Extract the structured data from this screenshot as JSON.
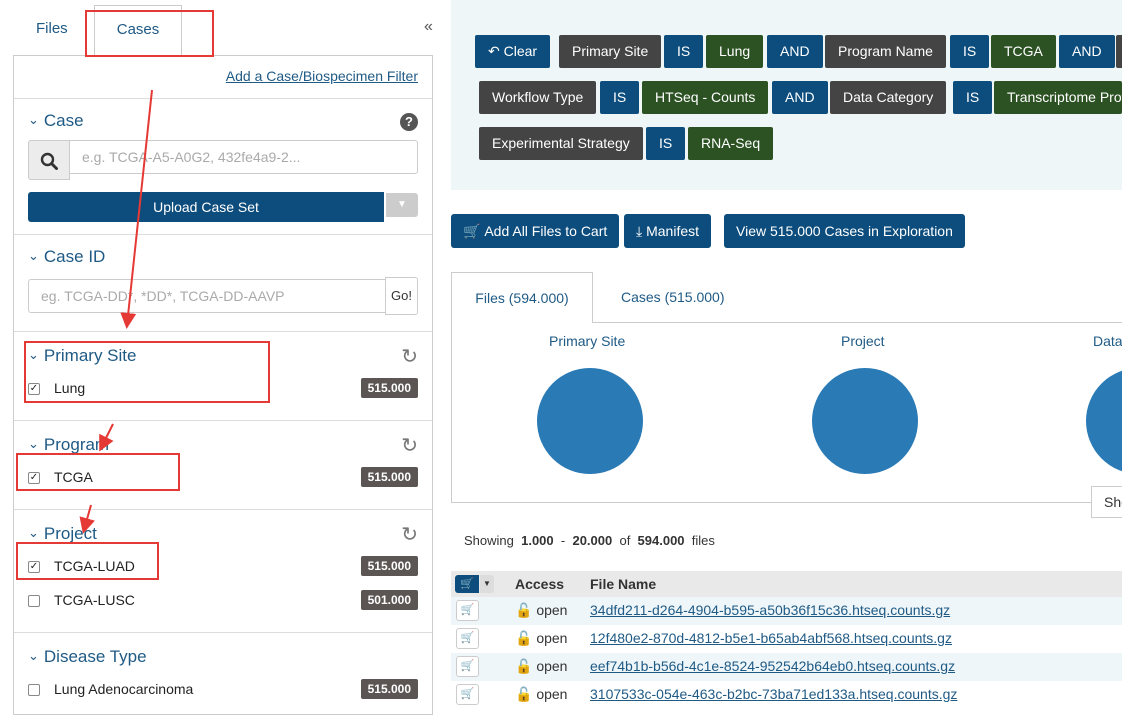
{
  "left_tabs": {
    "files": "Files",
    "cases": "Cases",
    "collapse": "«"
  },
  "add_filter": "Add a Case/Biospecimen Filter",
  "case_section": {
    "title": "Case",
    "help": "?",
    "search_placeholder": "e.g. TCGA-A5-A0G2, 432fe4a9-2...",
    "upload_label": "Upload Case Set"
  },
  "caseid_section": {
    "title": "Case ID",
    "placeholder": "eg. TCGA-DD*, *DD*, TCGA-DD-AAVP",
    "go": "Go!"
  },
  "facets": [
    {
      "title": "Primary Site",
      "items": [
        {
          "label": "Lung",
          "count": "515.000",
          "checked": true
        }
      ]
    },
    {
      "title": "Program",
      "items": [
        {
          "label": "TCGA",
          "count": "515.000",
          "checked": true
        }
      ]
    },
    {
      "title": "Project",
      "items": [
        {
          "label": "TCGA-LUAD",
          "count": "515.000",
          "checked": true
        },
        {
          "label": "TCGA-LUSC",
          "count": "501.000",
          "checked": false
        }
      ]
    },
    {
      "title": "Disease Type",
      "items": [
        {
          "label": "Lung Adenocarcinoma",
          "count": "515.000",
          "checked": false
        }
      ]
    }
  ],
  "query": {
    "clear": "Clear",
    "row1": [
      "Primary Site",
      "IS",
      "Lung",
      "AND",
      "Program Name",
      "IS",
      "TCGA",
      "AND"
    ],
    "row2": [
      "Workflow Type",
      "IS",
      "HTSeq - Counts",
      "AND",
      "Data Category",
      "IS",
      "Transcriptome Profiling"
    ],
    "row3": [
      "Experimental Strategy",
      "IS",
      "RNA-Seq"
    ]
  },
  "actions": {
    "add_all": "Add All Files to Cart",
    "manifest": "Manifest",
    "view_cases": "View 515.000 Cases in Exploration"
  },
  "result_tabs": {
    "files": "Files (594.000)",
    "cases": "Cases (515.000)"
  },
  "summary_charts": [
    "Primary Site",
    "Project",
    "Data Category"
  ],
  "show_button": "Show",
  "showing": {
    "prefix": "Showing",
    "from": "1.000",
    "dash": "-",
    "to": "20.000",
    "of": "of",
    "total": "594.000",
    "suffix": "files"
  },
  "table": {
    "headers": {
      "access": "Access",
      "file_name": "File Name"
    },
    "rows": [
      {
        "access": "open",
        "file": "34dfd211-d264-4904-b595-a50b36f15c36.htseq.counts.gz"
      },
      {
        "access": "open",
        "file": "12f480e2-870d-4812-b5e1-b65ab4abf568.htseq.counts.gz"
      },
      {
        "access": "open",
        "file": "eef74b1b-b56d-4c1e-8524-952542b64eb0.htseq.counts.gz"
      },
      {
        "access": "open",
        "file": "3107533c-054e-463c-b2bc-73ba71ed133a.htseq.counts.gz"
      }
    ]
  },
  "colors": {
    "brand_blue": "#0d4d7d",
    "chip_dark": "#444444",
    "chip_green": "#2c5223",
    "annotation_red": "#e53935",
    "pie_blue": "#2a7ab6"
  }
}
